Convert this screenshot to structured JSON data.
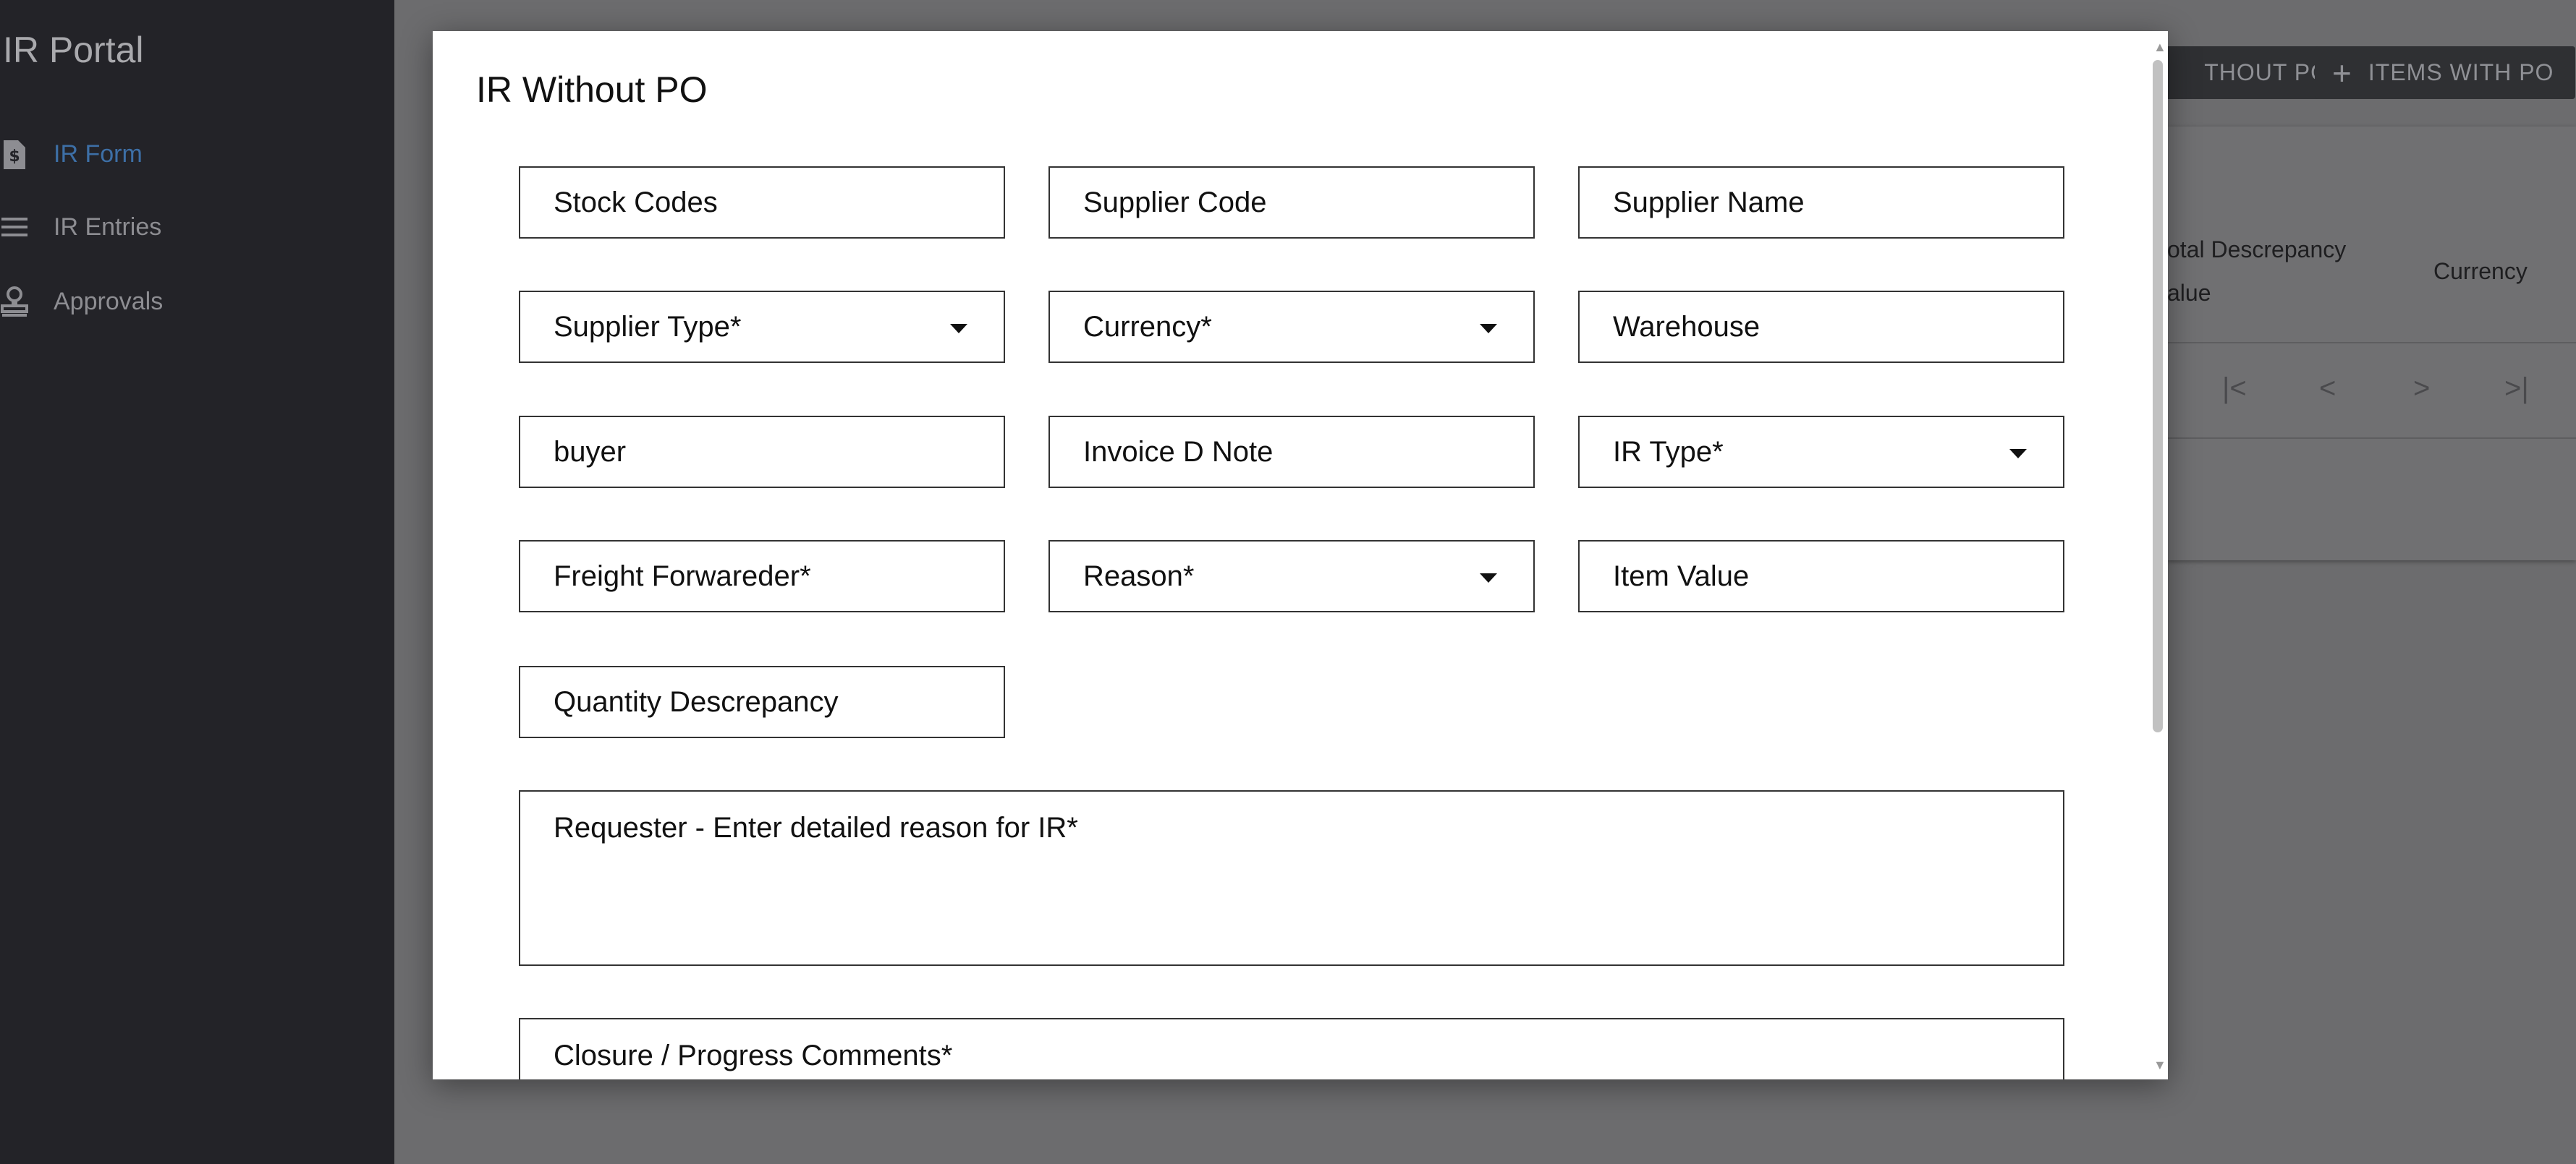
{
  "sidebar": {
    "title": "IR Portal",
    "items": [
      {
        "label": "IR Form",
        "icon": "invoice-icon",
        "active": true
      },
      {
        "label": "IR Entries",
        "icon": "list-icon",
        "active": false
      },
      {
        "label": "Approvals",
        "icon": "stamp-icon",
        "active": false
      }
    ]
  },
  "toolbar": {
    "without_po_label": "THOUT PO",
    "with_po_label": "ITEMS WITH PO",
    "with_po_icon": "plus-icon"
  },
  "table": {
    "columns": [
      "otal Descrepancy\nalue",
      "Currency"
    ],
    "pager": {
      "first": "first-page-icon",
      "prev": "prev-page-icon",
      "next": "next-page-icon",
      "last": "last-page-icon"
    }
  },
  "modal": {
    "title": "IR Without PO",
    "fields": {
      "stock_codes": "Stock Codes",
      "supplier_code": "Supplier Code",
      "supplier_name": "Supplier Name",
      "supplier_type": "Supplier Type*",
      "currency": "Currency*",
      "warehouse": "Warehouse",
      "buyer": "buyer",
      "invoice_d_note": "Invoice D Note",
      "ir_type": "IR Type*",
      "freight_forwarder": "Freight Forwareder*",
      "reason": "Reason*",
      "item_value": "Item Value",
      "quantity_descrepancy": "Quantity Descrepancy",
      "requester_reason": "Requester - Enter detailed reason for IR*",
      "closure_comments": "Closure / Progress Comments*"
    }
  },
  "colors": {
    "sidebar_bg": "#232328",
    "active_nav": "#3d6fa6",
    "overlay_bg": "#6c6c6e"
  }
}
